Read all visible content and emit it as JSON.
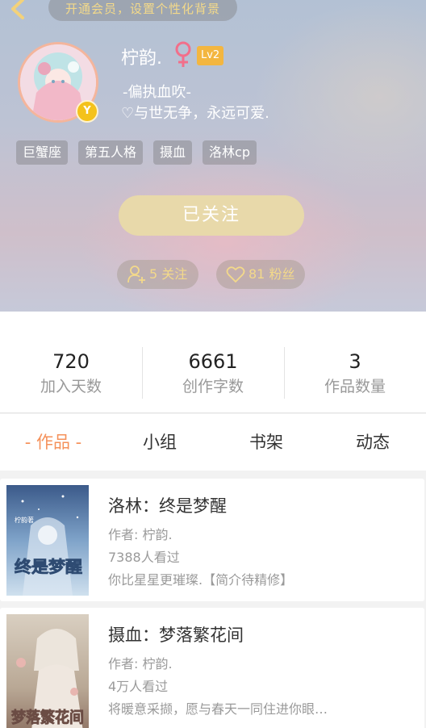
{
  "header": {
    "back_icon": "chevron-left-icon",
    "vip_banner": "开通会员，设置个性化背景",
    "username": "柠韵.",
    "gender_icon": "female-icon",
    "level": "Lv2",
    "vip_badge": "Y",
    "bio_line1": "-偏执血吹-",
    "bio_line2": "♡与世无争，永远可爱.",
    "tags": [
      "巨蟹座",
      "第五人格",
      "摄血",
      "洛林cp"
    ],
    "follow_button": "已关注",
    "following_count": "5 关注",
    "fans_count": "81 粉丝",
    "colors": {
      "accent_gold": "#f3d98a",
      "level_badge": "#f3b640",
      "follow_button": "#e8d9aa"
    }
  },
  "stats": [
    {
      "value": "720",
      "label": "加入天数"
    },
    {
      "value": "6661",
      "label": "创作字数"
    },
    {
      "value": "3",
      "label": "作品数量"
    }
  ],
  "tabs": [
    {
      "label": "- 作品 -",
      "active": true
    },
    {
      "label": "小组",
      "active": false
    },
    {
      "label": "书架",
      "active": false
    },
    {
      "label": "动态",
      "active": false
    }
  ],
  "works": [
    {
      "title": "洛林：终是梦醒",
      "author": "作者: 柠韵.",
      "views": "7388人看过",
      "description": "你比星星更璀璨.【简介待精修】",
      "cover_text": "终是梦醒",
      "cover_small_text": "柠韵著"
    },
    {
      "title": "摄血：梦落繁花间",
      "author": "作者: 柠韵.",
      "views": "4万人看过",
      "description": "将暖意采撷，愿与春天一同住进你眼…",
      "cover_text": "梦落繁花间"
    }
  ],
  "accent_color": "#f5915a"
}
